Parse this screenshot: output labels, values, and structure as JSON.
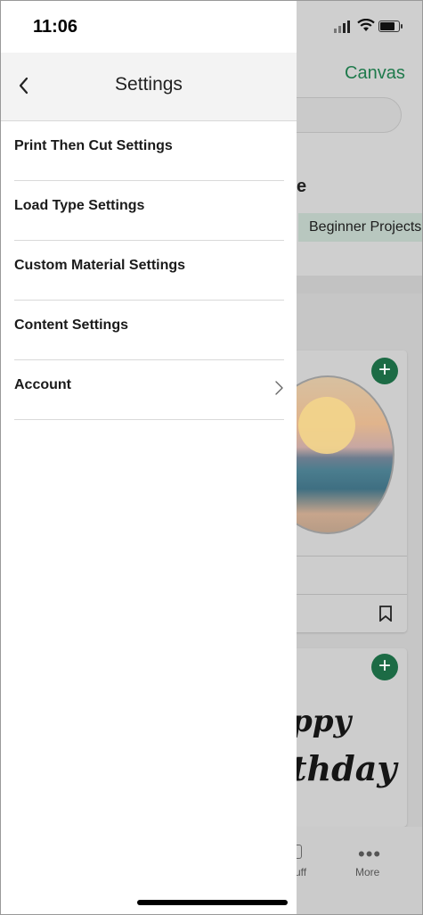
{
  "status_bar": {
    "time": "11:06"
  },
  "drawer": {
    "title": "Settings",
    "items": [
      {
        "label": "Print Then Cut Settings"
      },
      {
        "label": "Load Type Settings"
      },
      {
        "label": "Custom Material Settings"
      },
      {
        "label": "Content Settings"
      },
      {
        "label": "Account"
      }
    ]
  },
  "background_app": {
    "header_link": "Canvas",
    "section_fragment": "e",
    "chip_label": "Beginner Projects",
    "card2_text_line1": "ppy",
    "card2_text_line2": "thday",
    "tabs": {
      "stuff_label": "uff",
      "more_label": "More",
      "more_dots": "•••"
    },
    "accent_color": "#1c6b45"
  }
}
